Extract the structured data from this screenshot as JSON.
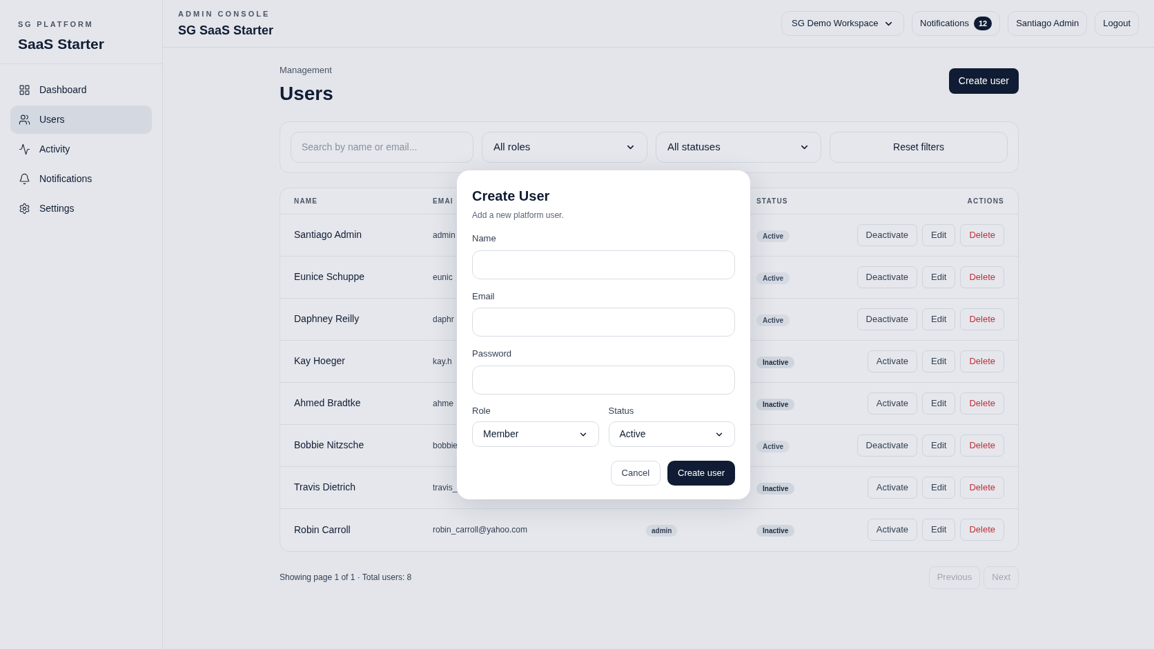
{
  "sidebar": {
    "eyebrow": "SG PLATFORM",
    "title": "SaaS Starter",
    "items": [
      {
        "label": "Dashboard",
        "selected": false
      },
      {
        "label": "Users",
        "selected": true
      },
      {
        "label": "Activity",
        "selected": false
      },
      {
        "label": "Notifications",
        "selected": false
      },
      {
        "label": "Settings",
        "selected": false
      }
    ]
  },
  "header": {
    "eyebrow": "ADMIN CONSOLE",
    "title": "SG SaaS Starter",
    "workspace": "SG Demo Workspace",
    "notifications": {
      "label": "Notifications",
      "count": "12"
    },
    "user": "Santiago Admin",
    "logout": "Logout"
  },
  "page": {
    "breadcrumb": "Management",
    "title": "Users",
    "create_button": "Create user"
  },
  "filters": {
    "search_placeholder": "Search by name or email...",
    "role": "All roles",
    "status": "All statuses",
    "reset": "Reset filters"
  },
  "table": {
    "columns": [
      "NAME",
      "EMAI",
      "STATUS",
      "ACTIONS"
    ],
    "rows": [
      {
        "name": "Santiago Admin",
        "email": "admin",
        "status": "Active",
        "active": true,
        "actions": [
          {
            "label": "Deactivate",
            "kind": "toggle"
          },
          {
            "label": "Edit",
            "kind": "edit"
          },
          {
            "label": "Delete",
            "kind": "delete"
          }
        ]
      },
      {
        "name": "Eunice Schuppe",
        "email": "eunic",
        "status": "Active",
        "active": true,
        "actions": [
          {
            "label": "Deactivate",
            "kind": "toggle"
          },
          {
            "label": "Edit",
            "kind": "edit"
          },
          {
            "label": "Delete",
            "kind": "delete"
          }
        ]
      },
      {
        "name": "Daphney Reilly",
        "email": "daphr",
        "status": "Active",
        "active": true,
        "actions": [
          {
            "label": "Deactivate",
            "kind": "toggle"
          },
          {
            "label": "Edit",
            "kind": "edit"
          },
          {
            "label": "Delete",
            "kind": "delete"
          }
        ]
      },
      {
        "name": "Kay Hoeger",
        "email": "kay.h",
        "status": "Inactive",
        "active": false,
        "actions": [
          {
            "label": "Activate",
            "kind": "toggle"
          },
          {
            "label": "Edit",
            "kind": "edit"
          },
          {
            "label": "Delete",
            "kind": "delete"
          }
        ]
      },
      {
        "name": "Ahmed Bradtke",
        "email": "ahme",
        "status": "Inactive",
        "active": false,
        "actions": [
          {
            "label": "Activate",
            "kind": "toggle"
          },
          {
            "label": "Edit",
            "kind": "edit"
          },
          {
            "label": "Delete",
            "kind": "delete"
          }
        ]
      },
      {
        "name": "Bobbie Nitzsche",
        "email": "bobbie",
        "status": "Active",
        "active": true,
        "actions": [
          {
            "label": "Deactivate",
            "kind": "toggle"
          },
          {
            "label": "Edit",
            "kind": "edit"
          },
          {
            "label": "Delete",
            "kind": "delete"
          }
        ]
      },
      {
        "name": "Travis Dietrich",
        "email": "travis_",
        "status": "Inactive",
        "active": false,
        "actions": [
          {
            "label": "Activate",
            "kind": "toggle"
          },
          {
            "label": "Edit",
            "kind": "edit"
          },
          {
            "label": "Delete",
            "kind": "delete"
          }
        ]
      },
      {
        "name": "Robin Carroll",
        "email": "robin_carroll@yahoo.com",
        "role": "admin",
        "status": "Inactive",
        "active": false,
        "actions": [
          {
            "label": "Activate",
            "kind": "toggle"
          },
          {
            "label": "Edit",
            "kind": "edit"
          },
          {
            "label": "Delete",
            "kind": "delete"
          }
        ]
      }
    ]
  },
  "footer": {
    "summary": "Showing page 1 of 1 · Total users: 8",
    "pages": [
      {
        "label": "Previous",
        "disabled": true
      },
      {
        "label": "Next",
        "disabled": true
      }
    ]
  },
  "modal": {
    "title": "Create User",
    "subtitle": "Add a new platform user.",
    "fields": [
      {
        "label": "Name"
      },
      {
        "label": "Email"
      },
      {
        "label": "Password"
      }
    ],
    "selects": [
      {
        "label": "Role",
        "value": "Member"
      },
      {
        "label": "Status",
        "value": "Active"
      }
    ],
    "buttons": [
      {
        "label": "Cancel",
        "kind": "secondary"
      },
      {
        "label": "Create user",
        "kind": "primary"
      }
    ]
  }
}
